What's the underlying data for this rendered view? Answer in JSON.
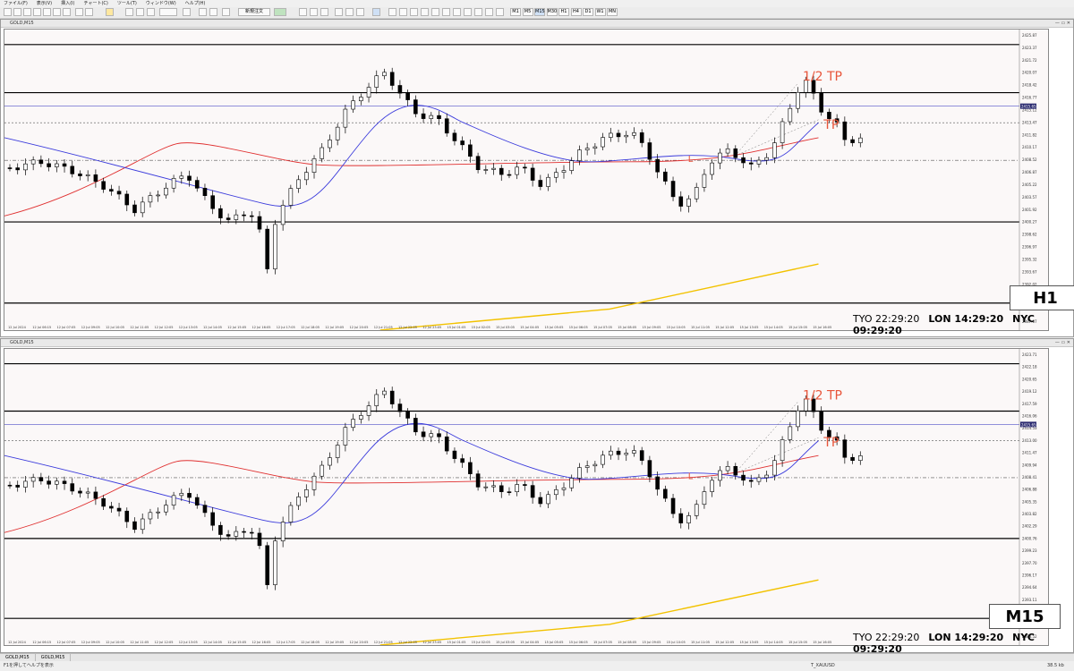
{
  "menu": [
    "ファイル(F)",
    "表示(V)",
    "挿入(I)",
    "チャート(C)",
    "ツール(T)",
    "ウィンドウ(W)",
    "ヘルプ(H)"
  ],
  "toolbar": {
    "new_order_label": "新規注文",
    "timeframes": [
      "M1",
      "M5",
      "M15",
      "M30",
      "H1",
      "H4",
      "D1",
      "W1",
      "MN"
    ]
  },
  "charts": [
    {
      "window_title": "GOLD,M15",
      "timeframe_label": "H1",
      "annotations": {
        "half_tp": "1/2 TP",
        "tp": "TP",
        "entry_marker": "L"
      },
      "clock": {
        "tyo": "TYO 22:29:20",
        "lon": "LON 14:29:20",
        "nyc": "NYC 09:29:20"
      },
      "price_labels": [
        "2425.87",
        "2423.37",
        "2421.72",
        "2420.07",
        "2418.42",
        "2416.77",
        "2415.12",
        "2413.47",
        "2411.82",
        "2410.17",
        "2408.52",
        "2406.87",
        "2405.22",
        "2403.57",
        "2401.92",
        "2400.27",
        "2398.62",
        "2396.97",
        "2395.32",
        "2393.67",
        "2392.02",
        "2390.37",
        "2388.72",
        "2387.07"
      ],
      "current_price": "2415.65",
      "time_labels": [
        "12 Jul 2024",
        "12 Jul 06:15",
        "12 Jul 07:05",
        "12 Jul 09:05",
        "12 Jul 10:05",
        "12 Jul 11:05",
        "12 Jul 12:05",
        "12 Jul 13:05",
        "12 Jul 14:05",
        "12 Jul 15:05",
        "12 Jul 16:05",
        "12 Jul 17:05",
        "12 Jul 18:05",
        "12 Jul 19:05",
        "12 Jul 20:05",
        "12 Jul 21:05",
        "12 Jul 22:05",
        "12 Jul 23:05",
        "15 Jul 01:05",
        "15 Jul 02:05",
        "15 Jul 03:05",
        "15 Jul 04:05",
        "15 Jul 05:05",
        "15 Jul 06:05",
        "15 Jul 07:05",
        "15 Jul 08:05",
        "15 Jul 09:05",
        "15 Jul 10:05",
        "15 Jul 11:05",
        "15 Jul 12:05",
        "15 Jul 13:05",
        "15 Jul 14:05",
        "15 Jul 15:05",
        "15 Jul 16:05"
      ]
    },
    {
      "window_title": "GOLD,M15",
      "timeframe_label": "M15",
      "annotations": {
        "half_tp": "1/2 TP",
        "tp": "TP",
        "entry_marker": "L"
      },
      "clock": {
        "tyo": "TYO 22:29:20",
        "lon": "LON 14:29:20",
        "nyc": "NYC 09:29:20"
      },
      "price_labels": [
        "2423.71",
        "2422.18",
        "2420.65",
        "2419.12",
        "2417.59",
        "2416.06",
        "2414.53",
        "2413.00",
        "2411.47",
        "2409.94",
        "2408.41",
        "2406.88",
        "2405.35",
        "2403.82",
        "2402.29",
        "2400.76",
        "2399.23",
        "2397.70",
        "2396.17",
        "2394.64",
        "2393.11",
        "2391.58",
        "2390.05",
        "2388.52"
      ],
      "current_price": "2415.65",
      "time_labels": [
        "12 Jul 2024",
        "12 Jul 06:15",
        "12 Jul 07:05",
        "12 Jul 09:05",
        "12 Jul 10:05",
        "12 Jul 11:05",
        "12 Jul 12:05",
        "12 Jul 13:05",
        "12 Jul 14:05",
        "12 Jul 15:05",
        "12 Jul 16:05",
        "12 Jul 17:05",
        "12 Jul 18:05",
        "12 Jul 19:05",
        "12 Jul 20:05",
        "12 Jul 21:05",
        "12 Jul 22:05",
        "12 Jul 23:05",
        "15 Jul 01:05",
        "15 Jul 02:05",
        "15 Jul 03:05",
        "15 Jul 04:05",
        "15 Jul 05:05",
        "15 Jul 06:05",
        "15 Jul 07:05",
        "15 Jul 08:05",
        "15 Jul 09:05",
        "15 Jul 10:05",
        "15 Jul 11:05",
        "15 Jul 12:05",
        "15 Jul 13:05",
        "15 Jul 14:05",
        "15 Jul 15:05",
        "15 Jul 16:05"
      ]
    }
  ],
  "bottom_tabs": [
    "GOLD,M15",
    "GOLD,M15"
  ],
  "status": {
    "help": "F1を押してヘルプを表示",
    "symbol": "T_XAUUSD",
    "net": "38.5 kb"
  },
  "colors": {
    "ma_blue": "#3b3bdc",
    "ma_red": "#e03030",
    "ma_yellow": "#f2c200",
    "annotation": "#e8553a",
    "bull": "#ffffff",
    "bear": "#000000"
  }
}
